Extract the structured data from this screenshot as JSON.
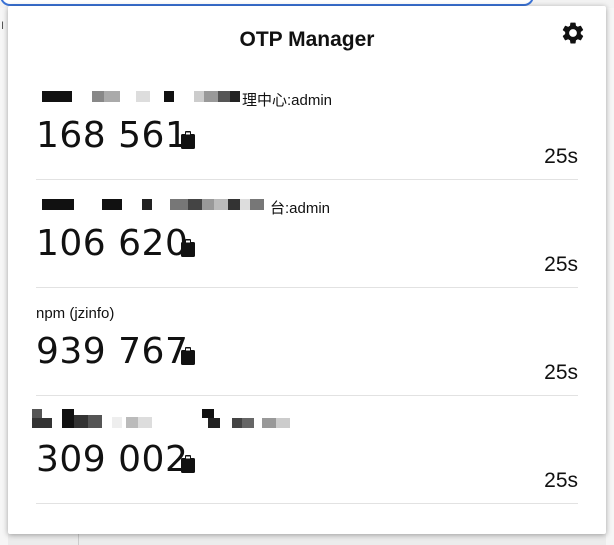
{
  "popup": {
    "title": "OTP Manager",
    "settings_icon": "gear-icon"
  },
  "accounts": [
    {
      "label_visible": "理中心:admin",
      "code": "168 561",
      "ttl": "25s"
    },
    {
      "label_visible": "台:admin",
      "code": "106 620",
      "ttl": "25s"
    },
    {
      "label_visible": "npm (jzinfo)",
      "code": "939 767",
      "ttl": "25s"
    },
    {
      "label_visible": "",
      "code": "309 002",
      "ttl": "25s"
    }
  ],
  "icons": {
    "copy": "clipboard-icon",
    "settings": "gear-icon"
  }
}
